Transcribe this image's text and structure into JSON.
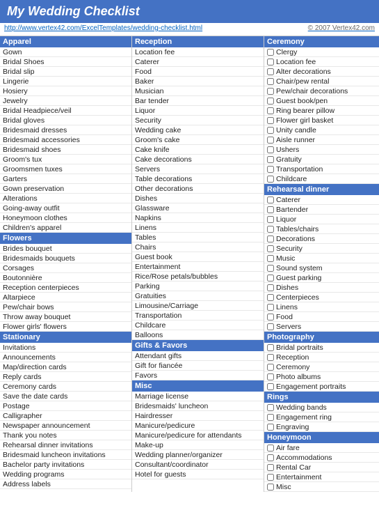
{
  "title": "My Wedding Checklist",
  "url": "http://www.vertex42.com/ExcelTemplates/wedding-checklist.html",
  "copyright": "© 2007 Vertex42.com",
  "columns": {
    "apparel": {
      "header": "Apparel",
      "items": [
        "Gown",
        "Bridal Shoes",
        "Bridal slip",
        "Lingerie",
        "Hosiery",
        "Jewelry",
        "Bridal Headpiece/veil",
        "Bridal gloves",
        "Bridesmaid dresses",
        "Bridesmaid accessories",
        "Bridesmaid shoes",
        "Groom's tux",
        "Groomsmen tuxes",
        "Garters",
        "Gown preservation",
        "Alterations",
        "Going-away outfit",
        "Honeymoon clothes",
        "Children's apparel"
      ]
    },
    "flowers": {
      "header": "Flowers",
      "items": [
        "Brides bouquet",
        "Bridesmaids bouquets",
        "Corsages",
        "Boutonnière",
        "Reception centerpieces",
        "Altarpiece",
        "Pew/chair bows",
        "Throw away bouquet",
        "Flower girls' flowers"
      ]
    },
    "stationary": {
      "header": "Stationary",
      "items": [
        "Invitations",
        "Announcements",
        "Map/direction cards",
        "Reply cards",
        "Ceremony cards",
        "Save the date cards",
        "Postage",
        "Calligrapher",
        "Newspaper announcement",
        "Thank you notes",
        "Rehearsal dinner invitations",
        "Bridesmaid luncheon invitations",
        "Bachelor party invitations",
        "Wedding programs",
        "Address labels"
      ]
    },
    "reception": {
      "header": "Reception",
      "items": [
        "Location fee",
        "Caterer",
        "Food",
        "Baker",
        "Musician",
        "Bar tender",
        "Liquor",
        "Security",
        "Wedding cake",
        "Groom's cake",
        "Cake knife",
        "Cake decorations",
        "Servers",
        "Table decorations",
        "Other decorations",
        "Dishes",
        "Glassware",
        "Napkins",
        "Linens",
        "Tables",
        "Chairs",
        "Guest book",
        "Entertainment",
        "Rice/Rose petals/bubbles",
        "Parking",
        "Gratuities",
        "Limousine/Carriage",
        "Transportation",
        "Childcare",
        "Balloons"
      ]
    },
    "gifts_favors": {
      "header": "Gifts & Favors",
      "items": [
        "Attendant gifts",
        "Gift for fiancée",
        "Favors"
      ]
    },
    "misc": {
      "header": "Misc",
      "items": [
        "Marriage license",
        "Bridesmaids' luncheon",
        "Hairdresser",
        "Manicure/pedicure",
        "Manicure/pedicure for attendants",
        "Make-up",
        "Wedding planner/organizer",
        "Consultant/coordinator",
        "Hotel for guests"
      ]
    },
    "ceremony": {
      "header": "Ceremony",
      "items": [
        "Clergy",
        "Location fee",
        "Alter decorations",
        "Chair/pew rental",
        "Pew/chair decorations",
        "Guest book/pen",
        "Ring bearer pillow",
        "Flower girl basket",
        "Unity candle",
        "Aisle runner",
        "Ushers",
        "Gratuity",
        "Transportation",
        "Childcare"
      ]
    },
    "rehearsal_dinner": {
      "header": "Rehearsal dinner",
      "items": [
        "Caterer",
        "Bartender",
        "Liquor",
        "Tables/chairs",
        "Decorations",
        "Security",
        "Music",
        "Sound system",
        "Guest parking",
        "Dishes",
        "Centerpieces",
        "Linens",
        "Food",
        "Servers"
      ]
    },
    "photography": {
      "header": "Photography",
      "items": [
        "Bridal portraits",
        "Reception",
        "Ceremony",
        "Photo albums",
        "Engagement portraits"
      ]
    },
    "rings": {
      "header": "Rings",
      "items": [
        "Wedding bands",
        "Engagement ring",
        "Engraving"
      ]
    },
    "honeymoon": {
      "header": "Honeymoon",
      "items": [
        "Air fare",
        "Accommodations",
        "Rental Car",
        "Entertainment",
        "Misc"
      ]
    }
  }
}
